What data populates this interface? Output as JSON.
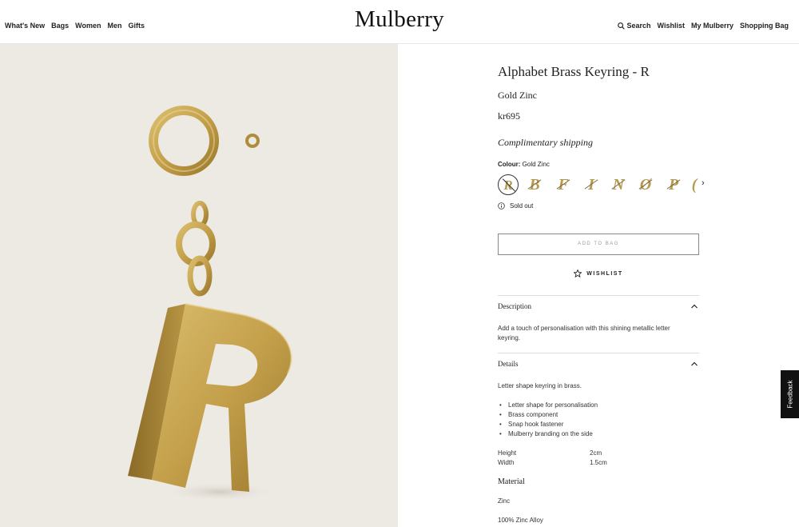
{
  "header": {
    "nav_left": [
      "What's New",
      "Bags",
      "Women",
      "Men",
      "Gifts"
    ],
    "logo": "Mulberry",
    "nav_right": {
      "search": "Search",
      "wishlist": "Wishlist",
      "account": "My Mulberry",
      "bag": "Shopping Bag"
    }
  },
  "product": {
    "title": "Alphabet Brass Keyring - R",
    "variant": "Gold Zinc",
    "price": "kr695",
    "shipping": "Complimentary shipping",
    "colour_label": "Colour:",
    "colour_value": "Gold Zinc",
    "letters": [
      "R",
      "B",
      "F",
      "I",
      "N",
      "Ø",
      "P",
      "("
    ],
    "selected_letter": "R",
    "stock_status": "Sold out",
    "add_to_bag": "ADD TO BAG",
    "wishlist": "WISHLIST"
  },
  "description": {
    "heading": "Description",
    "text": "Add a touch of personalisation with this shining metallic letter keyring."
  },
  "details": {
    "heading": "Details",
    "intro": "Letter shape keyring in brass.",
    "bullets": [
      "Letter shape for personalisation",
      "Brass component",
      "Snap hook fastener",
      "Mulberry branding on the side"
    ],
    "specs": [
      {
        "label": "Height",
        "value": "2cm"
      },
      {
        "label": "Width",
        "value": "1.5cm"
      }
    ]
  },
  "material": {
    "heading": "Material",
    "name": "Zinc",
    "composition": "100% Zinc Alloy"
  },
  "feedback_tab": "Feedback",
  "colors": {
    "gold": "#b79a52",
    "image_bg": "#ede9e3",
    "text": "#222222"
  }
}
